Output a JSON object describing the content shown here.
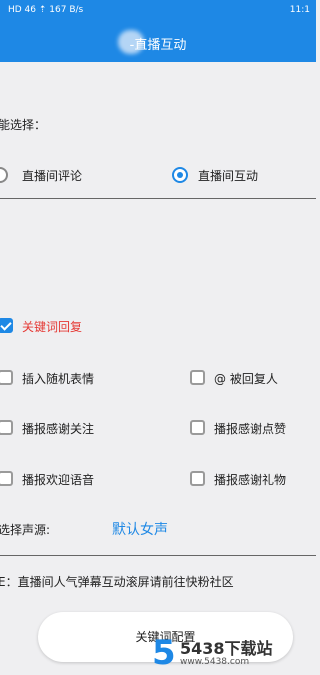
{
  "status": {
    "left_text": "HD 46 ⇡ 167 B/s",
    "right_text": "11:1"
  },
  "header": {
    "title": "-直播互动"
  },
  "function_section": {
    "label": "能选择：",
    "options": [
      {
        "label": "直播间评论",
        "selected": false
      },
      {
        "label": "直播间互动",
        "selected": true
      }
    ]
  },
  "keyword_reply": {
    "label": "关键词回复",
    "checked": true
  },
  "checkbox_rows": [
    {
      "left": "插入随机表情",
      "right": "@ 被回复人"
    },
    {
      "left": "播报感谢关注",
      "right": "播报感谢点赞"
    },
    {
      "left": "播报欢迎语音",
      "right": "播报感谢礼物"
    }
  ],
  "voice": {
    "label": "选择声源:",
    "value": "默认女声"
  },
  "note": "E：直播间人气弹幕互动滚屏请前往快粉社区",
  "config_button": "关键词配置",
  "watermark": {
    "logo": "5",
    "title": "5438下载站",
    "url": "www.5438.com"
  },
  "colors": {
    "accent": "#1e88e5",
    "keyword": "#e53935"
  }
}
